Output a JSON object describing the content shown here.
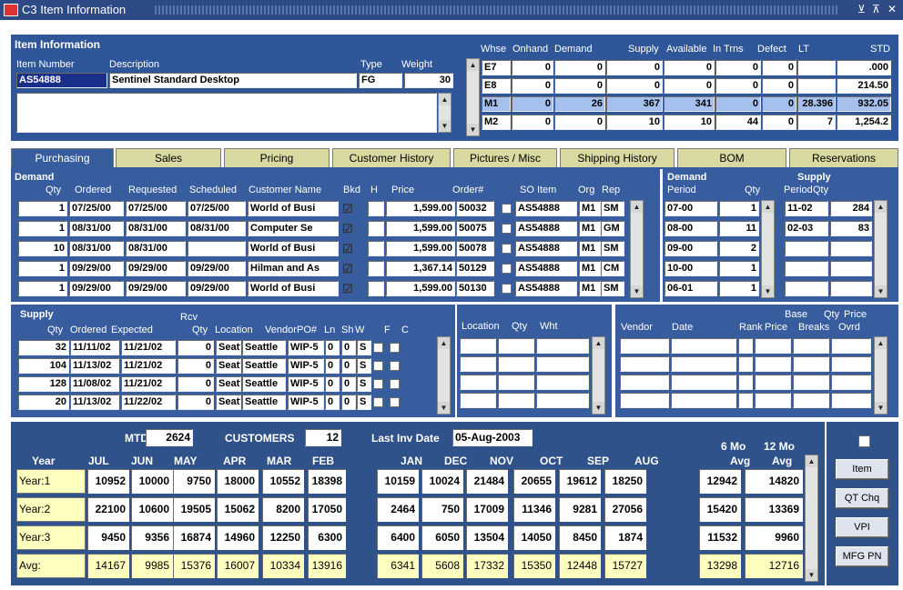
{
  "window": {
    "title": "C3 Item Information",
    "controls": [
      "⊻",
      "⊼",
      "✕"
    ]
  },
  "item": {
    "section_title": "Item Information",
    "labels": {
      "item_number": "Item Number",
      "description": "Description",
      "type": "Type",
      "weight": "Weight"
    },
    "item_number": "AS54888",
    "description": "Sentinel Standard Desktop",
    "type": "FG",
    "weight": "30",
    "notes": ""
  },
  "warehouse": {
    "headers": [
      "Whse",
      "Onhand",
      "Demand",
      "Supply",
      "Available",
      "In Trns",
      "Defect",
      "LT",
      "STD"
    ],
    "rows": [
      {
        "whse": "E7",
        "onhand": "0",
        "demand": "0",
        "supply": "0",
        "available": "0",
        "intrns": "0",
        "defect": "0",
        "lt": "",
        "std": ".000"
      },
      {
        "whse": "E8",
        "onhand": "0",
        "demand": "0",
        "supply": "0",
        "available": "0",
        "intrns": "0",
        "defect": "0",
        "lt": "",
        "std": "214.50"
      },
      {
        "whse": "M1",
        "onhand": "0",
        "demand": "26",
        "supply": "367",
        "available": "341",
        "intrns": "0",
        "defect": "0",
        "lt": "28.396",
        "std": "932.05"
      },
      {
        "whse": "M2",
        "onhand": "0",
        "demand": "0",
        "supply": "10",
        "available": "10",
        "intrns": "44",
        "defect": "0",
        "lt": "7",
        "std": "1,254.2"
      }
    ]
  },
  "tabs": [
    "Purchasing",
    "Sales",
    "Pricing",
    "Customer History",
    "Pictures / Misc",
    "Shipping History",
    "BOM",
    "Reservations"
  ],
  "demand": {
    "title": "Demand",
    "headers": [
      "Qty",
      "Ordered",
      "Requested",
      "Scheduled",
      "Customer Name",
      "Bkd",
      "H",
      "Price",
      "Order#",
      "SO Item",
      "Org",
      "Rep"
    ],
    "rows": [
      {
        "qty": "1",
        "ordered": "07/25/00",
        "requested": "07/25/00",
        "scheduled": "07/25/00",
        "customer": "World of Busi",
        "bkd": "☑",
        "price": "1,599.00",
        "order": "50032",
        "so_item": "AS54888",
        "org": "M1",
        "rep": "SM"
      },
      {
        "qty": "1",
        "ordered": "08/31/00",
        "requested": "08/31/00",
        "scheduled": "08/31/00",
        "customer": "Computer Se",
        "bkd": "☑",
        "price": "1,599.00",
        "order": "50075",
        "so_item": "AS54888",
        "org": "M1",
        "rep": "GM"
      },
      {
        "qty": "10",
        "ordered": "08/31/00",
        "requested": "08/31/00",
        "scheduled": "",
        "customer": "World of Busi",
        "bkd": "☑",
        "price": "1,599.00",
        "order": "50078",
        "so_item": "AS54888",
        "org": "M1",
        "rep": "SM"
      },
      {
        "qty": "1",
        "ordered": "09/29/00",
        "requested": "09/29/00",
        "scheduled": "09/29/00",
        "customer": "Hilman and As",
        "bkd": "☑",
        "price": "1,367.14",
        "order": "50129",
        "so_item": "AS54888",
        "org": "M1",
        "rep": "CM"
      },
      {
        "qty": "1",
        "ordered": "09/29/00",
        "requested": "09/29/00",
        "scheduled": "09/29/00",
        "customer": "World of Busi",
        "bkd": "☑",
        "price": "1,599.00",
        "order": "50130",
        "so_item": "AS54888",
        "org": "M1",
        "rep": "SM"
      }
    ]
  },
  "period_panel": {
    "demand_title": "Demand",
    "supply_title": "Supply",
    "headers": [
      "Period",
      "Qty",
      "Period",
      "Qty"
    ],
    "demand_rows": [
      {
        "period": "07-00",
        "qty": "1"
      },
      {
        "period": "08-00",
        "qty": "11"
      },
      {
        "period": "09-00",
        "qty": "2"
      },
      {
        "period": "10-00",
        "qty": "1"
      },
      {
        "period": "06-01",
        "qty": "1"
      }
    ],
    "supply_rows": [
      {
        "period": "11-02",
        "qty": "284"
      },
      {
        "period": "02-03",
        "qty": "83"
      },
      {
        "period": "",
        "qty": ""
      },
      {
        "period": "",
        "qty": ""
      },
      {
        "period": "",
        "qty": ""
      }
    ]
  },
  "supply": {
    "title": "Supply",
    "rcv_label": "Rcv",
    "headers": [
      "Qty",
      "Ordered",
      "Expected",
      "Qty",
      "Location",
      "Vendor",
      "PO#",
      "Ln",
      "Sh",
      "W",
      "F",
      "C"
    ],
    "rows": [
      {
        "qty": "32",
        "ordered": "11/11/02",
        "expected": "11/21/02",
        "rcv": "0",
        "location": "Seattle",
        "vendor": "Seattle",
        "po": "WIP-5",
        "ln": "0",
        "sh": "0",
        "w": "S"
      },
      {
        "qty": "104",
        "ordered": "11/13/02",
        "expected": "11/21/02",
        "rcv": "0",
        "location": "Seattle",
        "vendor": "Seattle",
        "po": "WIP-5",
        "ln": "0",
        "sh": "0",
        "w": "S"
      },
      {
        "qty": "128",
        "ordered": "11/08/02",
        "expected": "11/21/02",
        "rcv": "0",
        "location": "Seattle",
        "vendor": "Seattle",
        "po": "WIP-5",
        "ln": "0",
        "sh": "0",
        "w": "S"
      },
      {
        "qty": "20",
        "ordered": "11/13/02",
        "expected": "11/22/02",
        "rcv": "0",
        "location": "Seattle",
        "vendor": "Seattle",
        "po": "WIP-5",
        "ln": "0",
        "sh": "0",
        "w": "S"
      }
    ]
  },
  "location_panel": {
    "headers": [
      "Location",
      "Qty",
      "Wht"
    ]
  },
  "vendor_panel": {
    "headers": [
      "Vendor",
      "Date",
      "Rank",
      "Base Price",
      "Qty Breaks",
      "Price Ovrd"
    ],
    "base": "Base",
    "price": "Price",
    "qty": "Qty",
    "breaks": "Breaks",
    "price2": "Price",
    "ovrd": "Ovrd"
  },
  "sales": {
    "mtd_label": "MTD",
    "mtd_value": "2624",
    "customers_label": "CUSTOMERS",
    "customers_value": "12",
    "last_inv_label": "Last Inv Date",
    "last_inv_value": "05-Aug-2003",
    "headers": [
      "Year",
      "JUL",
      "JUN",
      "MAY",
      "APR",
      "MAR",
      "FEB",
      "JAN",
      "DEC",
      "NOV",
      "OCT",
      "SEP",
      "AUG"
    ],
    "avg6_top": "6 Mo",
    "avg6_bot": "Avg",
    "avg12_top": "12 Mo",
    "avg12_bot": "Avg",
    "rows": [
      {
        "label": "Year:1",
        "values": [
          "10952",
          "10000",
          "9750",
          "18000",
          "10552",
          "18398",
          "10159",
          "10024",
          "21484",
          "20655",
          "19612",
          "18250"
        ],
        "avg6": "12942",
        "avg12": "14820"
      },
      {
        "label": "Year:2",
        "values": [
          "22100",
          "10600",
          "19505",
          "15062",
          "8200",
          "17050",
          "2464",
          "750",
          "17009",
          "11346",
          "9281",
          "27056"
        ],
        "avg6": "15420",
        "avg12": "13369"
      },
      {
        "label": "Year:3",
        "values": [
          "9450",
          "9356",
          "16874",
          "14960",
          "12250",
          "6300",
          "6400",
          "6050",
          "13504",
          "14050",
          "8450",
          "1874"
        ],
        "avg6": "11532",
        "avg12": "9960"
      },
      {
        "label": "Avg:",
        "values": [
          "14167",
          "9985",
          "15376",
          "16007",
          "10334",
          "13916",
          "6341",
          "5608",
          "17332",
          "15350",
          "12448",
          "15727"
        ],
        "avg6": "13298",
        "avg12": "12716"
      }
    ],
    "buttons": [
      "Item",
      "QT Chq",
      "VPI",
      "MFG PN"
    ]
  },
  "colors": {
    "title_bar": "#2d4a84",
    "panel": "#c8ccd8",
    "selected": "#1a2f8a",
    "highlight_row": "#a6c0ee",
    "tab_inactive": "#d9d9a2",
    "tab_active": "#375d9f",
    "sales_panel": "#2e5289",
    "avg_row": "#ffffc0"
  }
}
